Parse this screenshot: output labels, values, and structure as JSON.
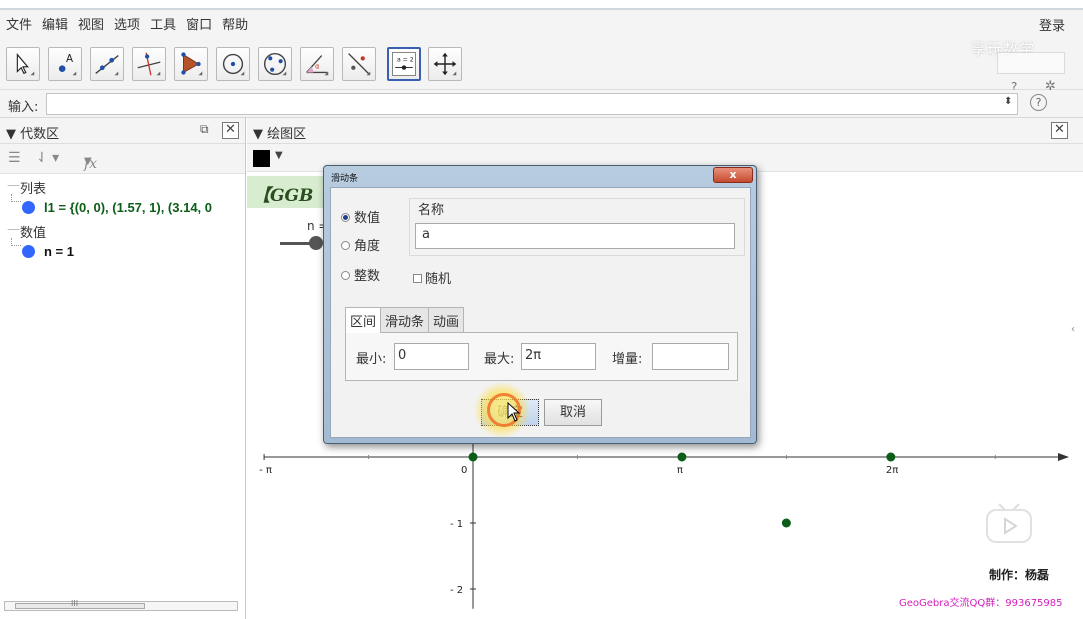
{
  "menubar": {
    "items": [
      "文件",
      "编辑",
      "视图",
      "选项",
      "工具",
      "窗口",
      "帮助"
    ],
    "login": "登录"
  },
  "watermark": "享玩数学",
  "toolbar": {
    "tools": [
      "move-tool",
      "point-tool",
      "line-tool",
      "perpendicular-line-tool",
      "polygon-tool",
      "circle-center-point-tool",
      "circle-three-points-tool",
      "angle-tool",
      "reflect-tool",
      "slider-tool",
      "move-graphics-view-tool"
    ],
    "slider_tool_label": "a = 2",
    "active_tool": "slider-tool"
  },
  "inputbar": {
    "label": "输入:",
    "value": "",
    "help_glyph": "?",
    "arrows": "⬍"
  },
  "algebra": {
    "title": "代数区",
    "fx_label": "fx",
    "groups": [
      {
        "label": "列表",
        "items": [
          {
            "text": "l1 = {(0, 0), (1.57, 1), (3.14, 0"
          }
        ]
      },
      {
        "label": "数值",
        "items": [
          {
            "text": "n = 1"
          }
        ]
      }
    ],
    "scroll_grip": "III"
  },
  "graphics": {
    "title": "绘图区",
    "banner": "【GGB",
    "slider_label": "n ="
  },
  "dialog": {
    "title": "滑动条",
    "close_glyph": "x",
    "radios": [
      "数值",
      "角度",
      "整数"
    ],
    "radio_selected": "数值",
    "name_label": "名称",
    "name_value": "a",
    "random_label": "随机",
    "tabs": [
      "区间",
      "滑动条",
      "动画"
    ],
    "active_tab": "区间",
    "min_label": "最小:",
    "min_value": "0",
    "max_label": "最大:",
    "max_value": "2π",
    "step_label": "增量:",
    "step_value": "",
    "ok_label": "确定",
    "cancel_label": "取消"
  },
  "credits": {
    "maker": "制作：杨磊",
    "group": "GeoGebra交流QQ群：993675985"
  },
  "colors": {
    "point_color": "#0b5d18",
    "algebra_text": "#0b5d18",
    "alg_dot": "#3366ff",
    "axis": "#333333"
  },
  "chart_data": {
    "type": "scatter",
    "x_tick_labels": [
      "- π",
      "0",
      "π",
      "2π"
    ],
    "y_tick_labels": [
      "- 1",
      "- 2"
    ],
    "xlim": [
      -3.14159,
      5.7
    ],
    "ylim": [
      -2.3,
      0.55
    ],
    "points": [
      {
        "x": 0,
        "y": 0
      },
      {
        "x": 3.14159,
        "y": 0
      },
      {
        "x": 4.71239,
        "y": -1
      },
      {
        "x": 6.28319,
        "y": 0
      }
    ]
  }
}
